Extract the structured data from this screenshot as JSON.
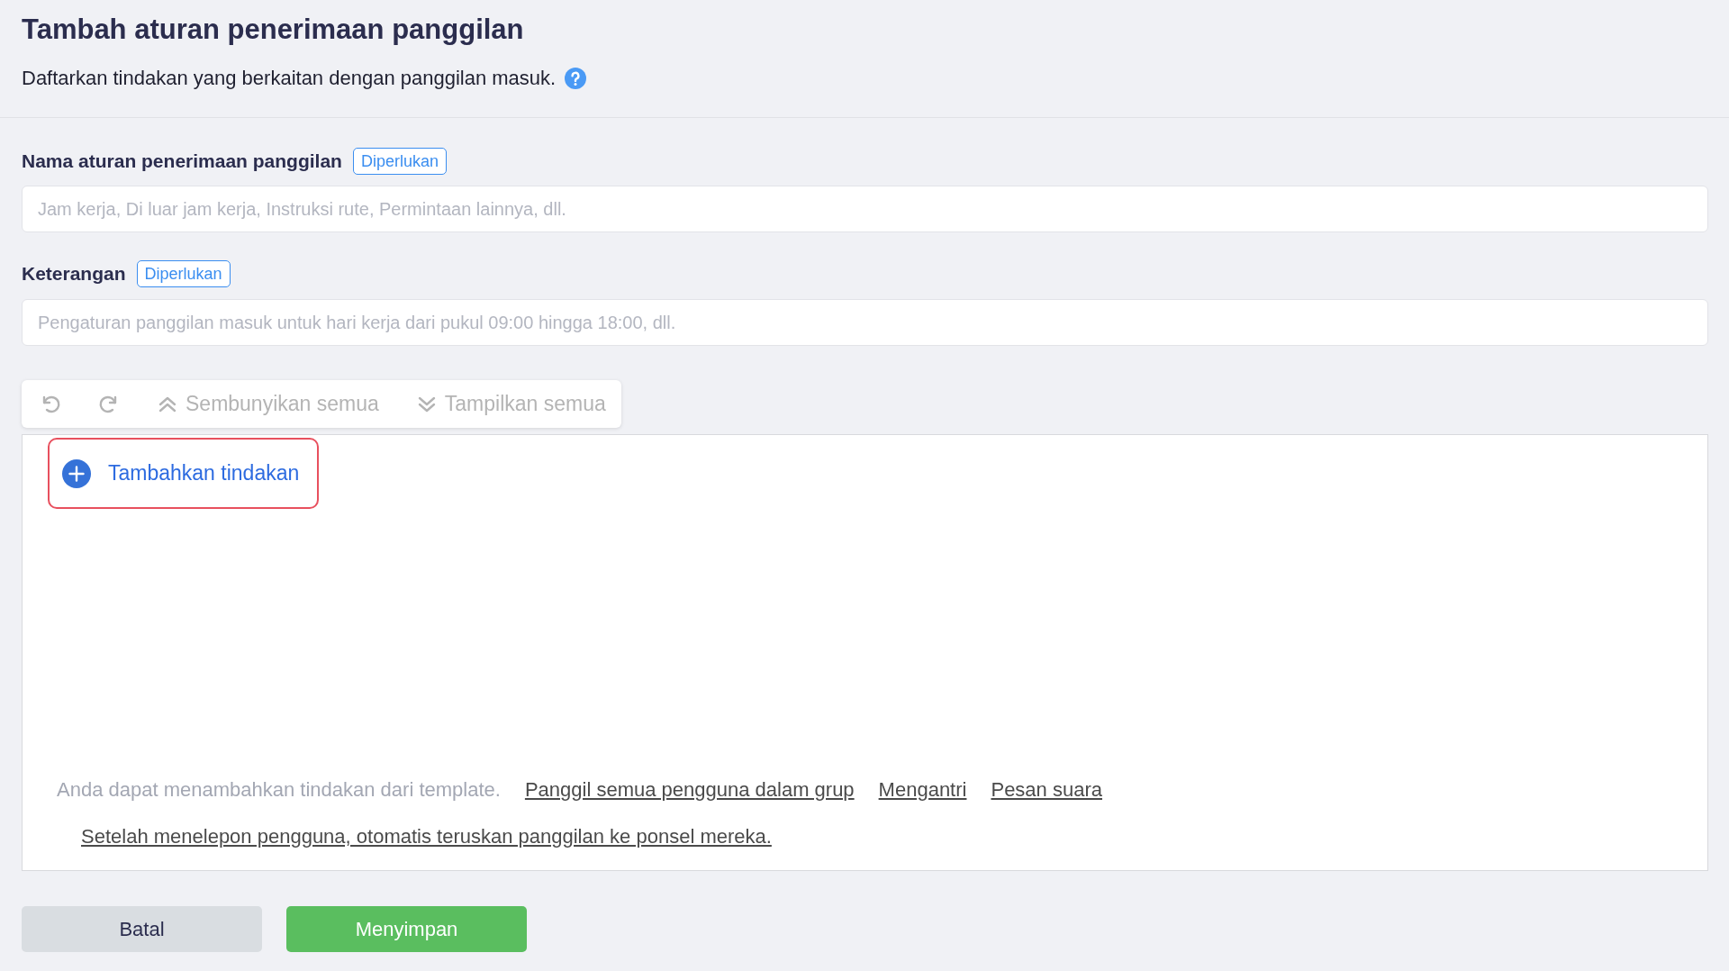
{
  "header": {
    "title": "Tambah aturan penerimaan panggilan",
    "subtitle": "Daftarkan tindakan yang berkaitan dengan panggilan masuk."
  },
  "fields": [
    {
      "label": "Nama aturan penerimaan panggilan",
      "badge": "Diperlukan",
      "placeholder": "Jam kerja, Di luar jam kerja, Instruksi rute, Permintaan lainnya, dll."
    },
    {
      "label": "Keterangan",
      "badge": "Diperlukan",
      "placeholder": "Pengaturan panggilan masuk untuk hari kerja dari pukul 09:00 hingga 18:00, dll."
    }
  ],
  "toolbar": {
    "items": [
      {
        "kind": "undo",
        "disabled": true
      },
      {
        "kind": "redo",
        "disabled": true
      },
      {
        "kind": "collapse",
        "label": "Sembunyikan semua",
        "disabled": true
      },
      {
        "kind": "expand",
        "label": "Tampilkan semua",
        "disabled": true
      }
    ]
  },
  "add_action": {
    "label": "Tambahkan tindakan",
    "highlighted": true
  },
  "templates": {
    "intro": "Anda dapat menambahkan tindakan dari template.",
    "links": [
      "Panggil semua pengguna dalam grup",
      "Mengantri",
      "Pesan suara",
      "Setelah menelepon pengguna, otomatis teruskan panggilan ke ponsel mereka."
    ]
  },
  "buttons": [
    {
      "label": "Batal",
      "kind": "secondary"
    },
    {
      "label": "Menyimpan",
      "kind": "primary"
    }
  ]
}
